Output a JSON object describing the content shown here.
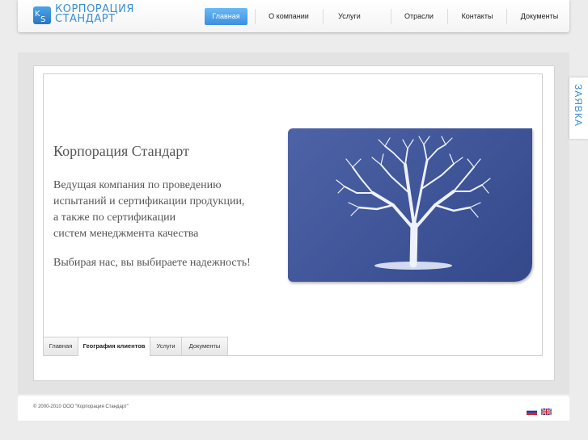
{
  "logo": {
    "line1": "КОРПОРАЦИЯ",
    "line2": "СТАНДАРТ"
  },
  "nav": [
    {
      "label": "Главная",
      "active": true
    },
    {
      "label": "О компании",
      "active": false
    },
    {
      "label": "Услуги",
      "active": false
    },
    {
      "label": "Отрасли",
      "active": false
    },
    {
      "label": "Контакты",
      "active": false
    },
    {
      "label": "Документы",
      "active": false
    }
  ],
  "slide": {
    "title": "Корпорация Стандарт",
    "desc": [
      "Ведущая компания по проведению",
      "испытаний и сертификации продукции,",
      "а также по сертификации",
      "систем менеджмента качества"
    ],
    "motto": "Выбирая нас, вы выбираете надежность!"
  },
  "tabs": [
    {
      "label": "Главная",
      "active": false
    },
    {
      "label": "География клиентов",
      "active": true
    },
    {
      "label": "Услуги",
      "active": false
    },
    {
      "label": "Документы",
      "active": false
    }
  ],
  "side_tab": {
    "label": "ЗАЯВКА"
  },
  "footer": {
    "copyright": "© 2000-2010 ООО \"Корпорация Стандарт\""
  },
  "colors": {
    "accent": "#3a8fd8",
    "tree_bg": "#3d5396"
  }
}
